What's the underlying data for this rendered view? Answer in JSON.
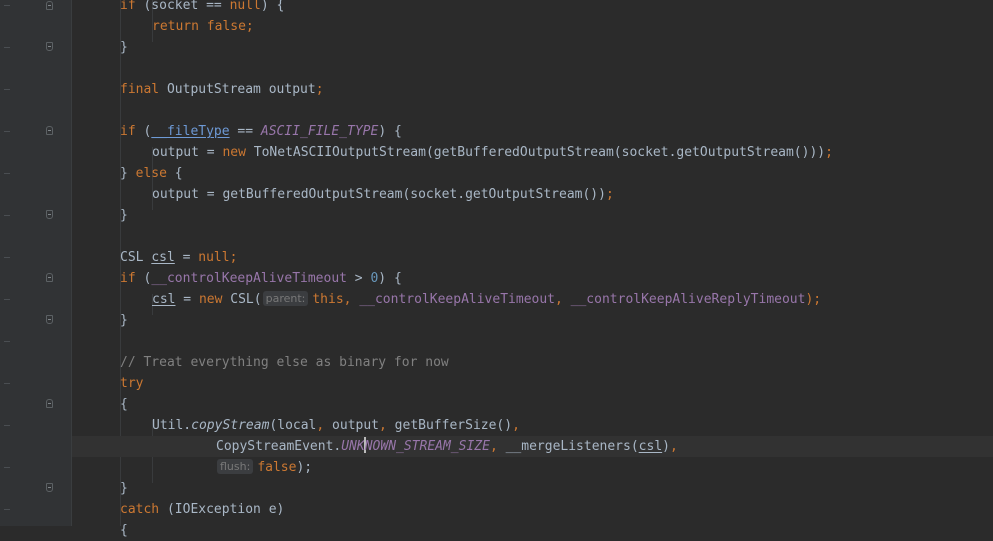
{
  "editor": {
    "language": "java",
    "colors": {
      "background": "#2b2b2b",
      "gutter": "#313335",
      "keyword": "#cc7832",
      "field": "#9876aa",
      "number": "#6897bb",
      "comment": "#808080",
      "default": "#a9b7c6"
    },
    "lines": {
      "l1": {
        "a": "if",
        "b": " (socket == ",
        "c": "null",
        "d": ") {"
      },
      "l2": {
        "a": "return false;"
      },
      "l3": {
        "a": "}"
      },
      "l5": {
        "a": "final",
        "b": " OutputStream output",
        "c": ";"
      },
      "l7": {
        "a": "if",
        "b": " (",
        "c": "__fileType",
        "d": " == ",
        "e": "ASCII_FILE_TYPE",
        "f": ") {"
      },
      "l8": {
        "a": "output = ",
        "b": "new",
        "c": " ToNetASCIIOutputStream(getBufferedOutputStream(socket.getOutputStream()))",
        "d": ";"
      },
      "l9": {
        "a": "} ",
        "b": "else",
        "c": " {"
      },
      "l10": {
        "a": "output = getBufferedOutputStream(socket.getOutputStream())",
        "b": ";"
      },
      "l11": {
        "a": "}"
      },
      "l13": {
        "a": "CSL ",
        "b": "csl",
        "c": " = ",
        "d": "null;"
      },
      "l14": {
        "a": "if",
        "b": " (",
        "c": "__controlKeepAliveTimeout",
        "d": " > ",
        "e": "0",
        "f": ") {"
      },
      "l15": {
        "a": "csl",
        "b": " = ",
        "c": "new",
        "d": " CSL(",
        "hint": "parent:",
        "e": "this, ",
        "f": "__controlKeepAliveTimeout",
        "g": ", ",
        "h": "__controlKeepAliveReplyTimeout",
        "i": ");"
      },
      "l16": {
        "a": "}"
      },
      "l18": {
        "a": "// Treat everything else as binary for now"
      },
      "l19": {
        "a": "try"
      },
      "l20": {
        "a": "{"
      },
      "l21": {
        "a": "Util.",
        "b": "copyStream",
        "c": "(local",
        "d": ", ",
        "e": "output",
        "f": ", ",
        "g": "getBufferSize()",
        "h": ","
      },
      "l22": {
        "a": "CopyStreamEvent.",
        "b1": "UNK",
        "b2": "NOWN_STREAM_SIZE",
        "c": ", ",
        "d": "__mergeListeners(",
        "e": "csl",
        "f": ")",
        "g": ","
      },
      "l23": {
        "hint": "flush:",
        "a": "false",
        "b": ");"
      },
      "l24": {
        "a": "}"
      },
      "l25": {
        "a": "catch",
        "b": " (IOException e)"
      },
      "l26": {
        "a": "{"
      }
    }
  }
}
